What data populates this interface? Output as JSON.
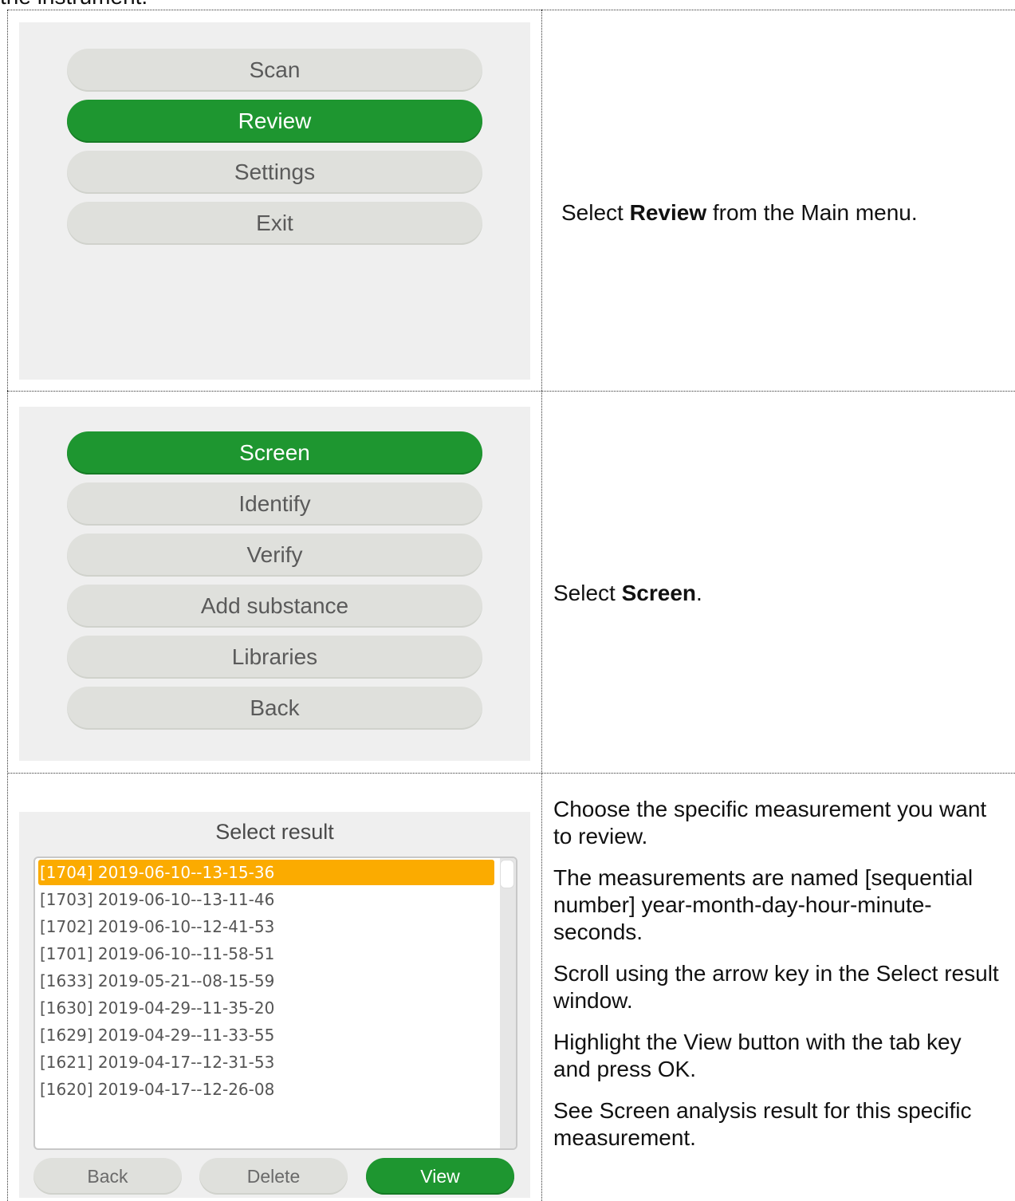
{
  "page": {
    "intro_text": "the instrument."
  },
  "step1": {
    "menu_items": [
      {
        "label": "Scan",
        "selected": false
      },
      {
        "label": "Review",
        "selected": true
      },
      {
        "label": "Settings",
        "selected": false
      },
      {
        "label": "Exit",
        "selected": false
      }
    ],
    "desc_pre": "Select ",
    "desc_bold": "Review",
    "desc_post": " from the Main menu."
  },
  "step2": {
    "menu_items": [
      {
        "label": "Screen",
        "selected": true
      },
      {
        "label": "Identify",
        "selected": false
      },
      {
        "label": "Verify",
        "selected": false
      },
      {
        "label": "Add substance",
        "selected": false
      },
      {
        "label": "Libraries",
        "selected": false
      },
      {
        "label": "Back",
        "selected": false
      }
    ],
    "desc_pre": "Select ",
    "desc_bold": "Screen",
    "desc_post": "."
  },
  "step3": {
    "window_title": "Select result",
    "results": [
      {
        "label": "[1704] 2019-06-10--13-15-36",
        "selected": true
      },
      {
        "label": "[1703] 2019-06-10--13-11-46",
        "selected": false
      },
      {
        "label": "[1702] 2019-06-10--12-41-53",
        "selected": false
      },
      {
        "label": "[1701] 2019-06-10--11-58-51",
        "selected": false
      },
      {
        "label": "[1633] 2019-05-21--08-15-59",
        "selected": false
      },
      {
        "label": "[1630] 2019-04-29--11-35-20",
        "selected": false
      },
      {
        "label": "[1629] 2019-04-29--11-33-55",
        "selected": false
      },
      {
        "label": "[1621] 2019-04-17--12-31-53",
        "selected": false
      },
      {
        "label": "[1620] 2019-04-17--12-26-08",
        "selected": false
      }
    ],
    "buttons": {
      "back": "Back",
      "delete": "Delete",
      "view": "View"
    },
    "paragraphs": [
      "Choose the specific measurement you want to review.",
      "The measurements are named [sequential number] year-month-day-hour-minute- seconds.",
      "Scroll using the arrow key in the Select result window.",
      "Highlight the View button with the tab key and press OK.",
      "See Screen analysis result for this specific measurement."
    ]
  },
  "colors": {
    "selected_green": "#1e9630",
    "selected_orange": "#fbab00",
    "button_gray": "#dfe0dc",
    "screen_bg": "#efefef"
  }
}
